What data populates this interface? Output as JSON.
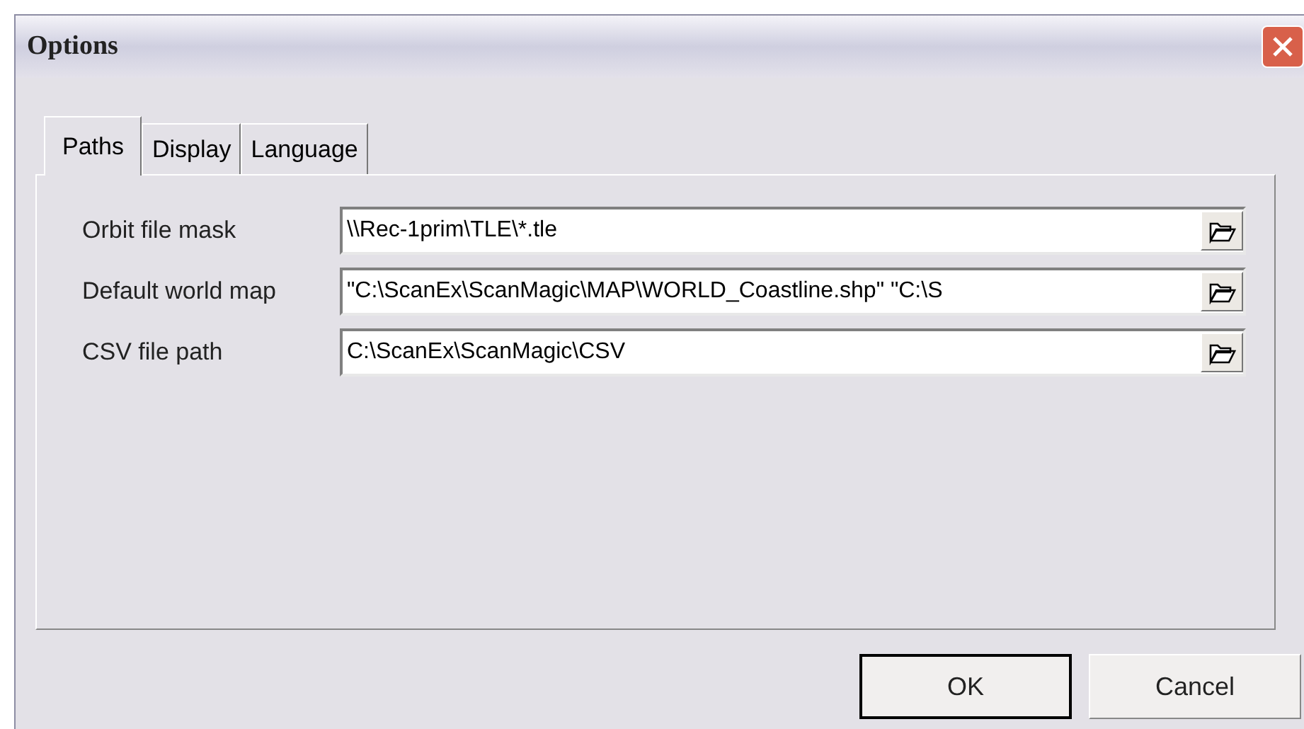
{
  "window": {
    "title": "Options"
  },
  "tabs": [
    {
      "label": "Paths",
      "selected": true
    },
    {
      "label": "Display",
      "selected": false
    },
    {
      "label": "Language",
      "selected": false
    }
  ],
  "fields": [
    {
      "label": "Orbit file mask",
      "value": "\\\\Rec-1prim\\TLE\\*.tle"
    },
    {
      "label": "Default world map",
      "value": "\"C:\\ScanEx\\ScanMagic\\MAP\\WORLD_Coastline.shp\" \"C:\\S"
    },
    {
      "label": "CSV file path",
      "value": "C:\\ScanEx\\ScanMagic\\CSV"
    }
  ],
  "buttons": [
    {
      "label": "OK",
      "default": true
    },
    {
      "label": "Cancel",
      "default": false
    }
  ]
}
